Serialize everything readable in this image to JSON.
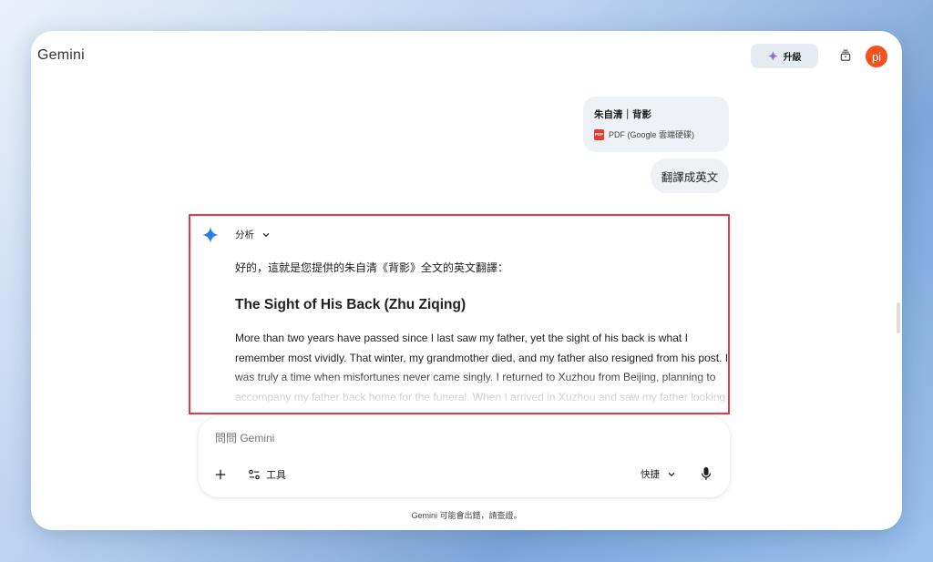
{
  "header": {
    "app_title": "Gemini",
    "upgrade_label": "升級",
    "avatar_initials": "pi",
    "avatar_color": "#f4511e"
  },
  "conversation": {
    "file": {
      "name": "朱自清｜背影",
      "type_label": "PDF (Google 雲端硬碟)",
      "badge": "PDF"
    },
    "user_message": "翻譯成英文",
    "response": {
      "analysis_label": "分析",
      "intro": "好的，這就是您提供的朱自清《背影》全文的英文翻譯：",
      "title": "The Sight of His Back (Zhu Ziqing)",
      "body": "More than two years have passed since I last saw my father, yet the sight of his back is what I remember most vividly. That winter, my grandmother died, and my father also resigned from his post. It was truly a time when misfortunes never came singly. I returned to Xuzhou from Beijing, planning to accompany my father back home for the funeral. When I arrived in Xuzhou and saw my father looking at the mess, I was also grieving all over the courtyard and thinking of my"
    }
  },
  "composer": {
    "placeholder": "問問 Gemini",
    "tools_label": "工具",
    "quick_label": "快捷"
  },
  "footer": {
    "disclaimer": "Gemini 可能會出錯，請查證。"
  },
  "colors": {
    "accent_blue": "#4285f4",
    "highlight_border": "#e53945"
  }
}
